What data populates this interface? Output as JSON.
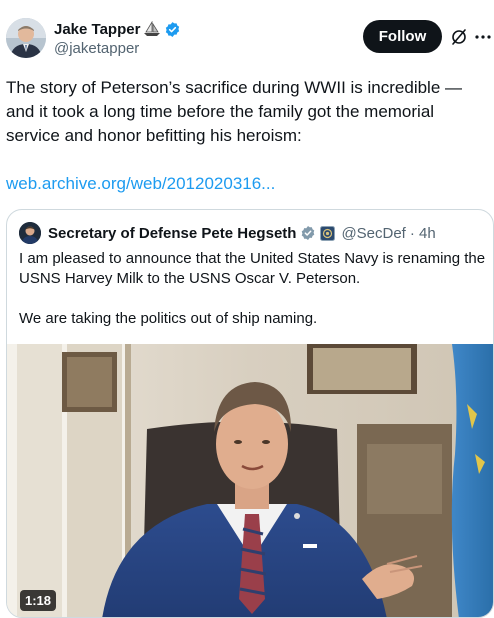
{
  "tweet": {
    "author": {
      "display_name": "Jake Tapper",
      "handle": "@jaketapper",
      "emoji_icon": "sailboat-icon",
      "verified_icon": "verified-badge-icon"
    },
    "follow_label": "Follow",
    "text": "The story of  Peterson’s sacrifice during WWII is incredible — and it took a long time before the family got the memorial service and honor befitting his heroism:",
    "link_text": "web.archive.org/web/2012020316..."
  },
  "quoted_tweet": {
    "author": {
      "display_name": "Secretary of Defense Pete Hegseth",
      "handle": "@SecDef",
      "time": " · 4h"
    },
    "paragraph_1": "I am pleased to announce that the United States Navy is renaming the USNS Harvey Milk to the USNS Oscar V. Peterson.",
    "paragraph_2": "We are taking the politics out of ship naming.",
    "video": {
      "duration": "1:18"
    }
  },
  "colors": {
    "accent": "#1d9bf0",
    "text": "#0f1419",
    "secondary_text": "#536471",
    "border": "#cfd9de",
    "follow_bg": "#0f1419"
  }
}
